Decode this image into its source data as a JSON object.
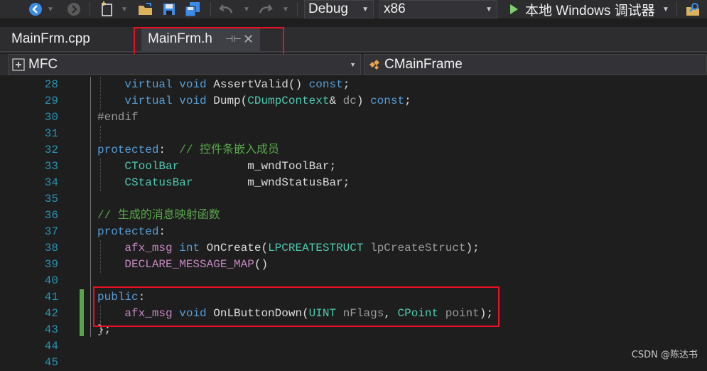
{
  "toolbar": {
    "config": "Debug",
    "platform": "x86",
    "run_label": "本地 Windows 调试器"
  },
  "tabs": [
    {
      "label": "MainFrm.cpp",
      "active": false
    },
    {
      "label": "MainFrm.h",
      "active": true
    }
  ],
  "nav": {
    "project": "MFC",
    "scope": "CMainFrame"
  },
  "editor": {
    "lines": [
      {
        "num": "28",
        "segments": [
          {
            "t": "    "
          },
          {
            "t": "virtual",
            "c": "kw"
          },
          {
            "t": " "
          },
          {
            "t": "void",
            "c": "kw"
          },
          {
            "t": " AssertValid() "
          },
          {
            "t": "const",
            "c": "kw"
          },
          {
            "t": ";"
          }
        ]
      },
      {
        "num": "29",
        "segments": [
          {
            "t": "    "
          },
          {
            "t": "virtual",
            "c": "kw"
          },
          {
            "t": " "
          },
          {
            "t": "void",
            "c": "kw"
          },
          {
            "t": " Dump("
          },
          {
            "t": "CDumpContext",
            "c": "type"
          },
          {
            "t": "& "
          },
          {
            "t": "dc",
            "c": "param"
          },
          {
            "t": ") "
          },
          {
            "t": "const",
            "c": "kw"
          },
          {
            "t": ";"
          }
        ]
      },
      {
        "num": "30",
        "segments": [
          {
            "t": "#endif",
            "c": "pp"
          }
        ]
      },
      {
        "num": "31",
        "segments": []
      },
      {
        "num": "32",
        "segments": [
          {
            "t": "protected",
            "c": "kw"
          },
          {
            "t": ":  "
          },
          {
            "t": "// 控件条嵌入成员",
            "c": "cm"
          }
        ]
      },
      {
        "num": "33",
        "segments": [
          {
            "t": "    "
          },
          {
            "t": "CToolBar",
            "c": "type"
          },
          {
            "t": "          m_wndToolBar;"
          }
        ]
      },
      {
        "num": "34",
        "segments": [
          {
            "t": "    "
          },
          {
            "t": "CStatusBar",
            "c": "type"
          },
          {
            "t": "        m_wndStatusBar;"
          }
        ]
      },
      {
        "num": "35",
        "segments": []
      },
      {
        "num": "36",
        "segments": [
          {
            "t": "// 生成的消息映射函数",
            "c": "cm"
          }
        ]
      },
      {
        "num": "37",
        "segments": [
          {
            "t": "protected",
            "c": "kw"
          },
          {
            "t": ":"
          }
        ]
      },
      {
        "num": "38",
        "segments": [
          {
            "t": "    "
          },
          {
            "t": "afx_msg",
            "c": "macro"
          },
          {
            "t": " "
          },
          {
            "t": "int",
            "c": "kw"
          },
          {
            "t": " OnCreate("
          },
          {
            "t": "LPCREATESTRUCT",
            "c": "type"
          },
          {
            "t": " "
          },
          {
            "t": "lpCreateStruct",
            "c": "param"
          },
          {
            "t": ");"
          }
        ]
      },
      {
        "num": "39",
        "segments": [
          {
            "t": "    "
          },
          {
            "t": "DECLARE_MESSAGE_MAP",
            "c": "macro"
          },
          {
            "t": "()"
          }
        ]
      },
      {
        "num": "40",
        "segments": []
      },
      {
        "num": "41",
        "segments": [
          {
            "t": "public",
            "c": "kw"
          },
          {
            "t": ":"
          }
        ]
      },
      {
        "num": "42",
        "segments": [
          {
            "t": "    "
          },
          {
            "t": "afx_msg",
            "c": "macro"
          },
          {
            "t": " "
          },
          {
            "t": "void",
            "c": "kw"
          },
          {
            "t": " OnLButtonDown("
          },
          {
            "t": "UINT",
            "c": "type"
          },
          {
            "t": " "
          },
          {
            "t": "nFlags",
            "c": "param"
          },
          {
            "t": ", "
          },
          {
            "t": "CPoint",
            "c": "type"
          },
          {
            "t": " "
          },
          {
            "t": "point",
            "c": "param"
          },
          {
            "t": ");"
          }
        ]
      },
      {
        "num": "43",
        "segments": [
          {
            "t": "};"
          }
        ]
      },
      {
        "num": "44",
        "segments": []
      },
      {
        "num": "45",
        "segments": []
      }
    ]
  },
  "watermark": "CSDN @陈达书",
  "colors": {
    "keyword": "#569cd6",
    "type": "#4ec9b0",
    "macro": "#c586c0",
    "comment": "#57a64a",
    "line_number": "#2b91af",
    "highlight_box": "#e81123"
  }
}
